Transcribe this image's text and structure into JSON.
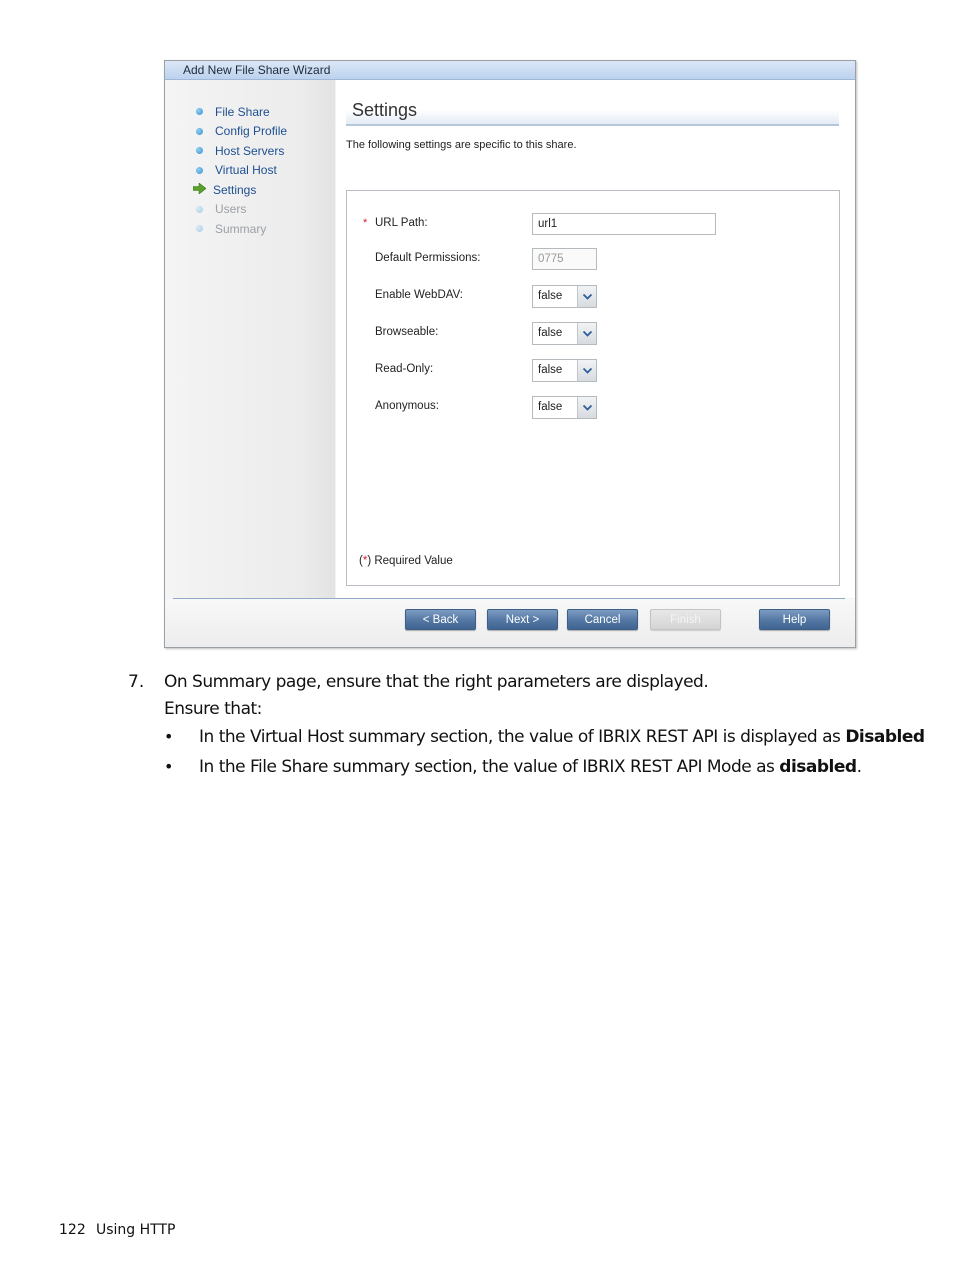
{
  "wizard": {
    "title": "Add New File Share Wizard",
    "nav": [
      {
        "label": "File Share",
        "state": "done",
        "icon": "bullet-icon"
      },
      {
        "label": "Config Profile",
        "state": "done",
        "icon": "bullet-icon"
      },
      {
        "label": "Host Servers",
        "state": "done",
        "icon": "bullet-icon"
      },
      {
        "label": "Virtual Host",
        "state": "done",
        "icon": "bullet-icon"
      },
      {
        "label": "Settings",
        "state": "current",
        "icon": "arrow-right-icon"
      },
      {
        "label": "Users",
        "state": "pending",
        "icon": "bullet-icon"
      },
      {
        "label": "Summary",
        "state": "pending",
        "icon": "bullet-icon"
      }
    ],
    "section_title": "Settings",
    "section_description": "The following settings are specific to this share.",
    "form": {
      "url_path": {
        "label": "URL Path:",
        "value": "url1",
        "required": true,
        "required_marker": "*"
      },
      "default_permissions": {
        "label": "Default Permissions:",
        "value": "0775"
      },
      "enable_webdav": {
        "label": "Enable WebDAV:",
        "value": "false"
      },
      "browseable": {
        "label": "Browseable:",
        "value": "false"
      },
      "read_only": {
        "label": "Read-Only:",
        "value": "false"
      },
      "anonymous": {
        "label": "Anonymous:",
        "value": "false"
      }
    },
    "required_note": {
      "prefix": "(",
      "star": "*",
      "suffix": ") Required Value"
    },
    "buttons": {
      "back": "< Back",
      "next": "Next >",
      "cancel": "Cancel",
      "finish": "Finish",
      "help": "Help"
    },
    "colors": {
      "accent": "#1d4f91",
      "button": "#5679a5",
      "required": "#d0203a",
      "current_step_arrow": "#5aa02c"
    }
  },
  "document": {
    "step_number": "7.",
    "step_text": "On Summary page, ensure that the right parameters are displayed.",
    "ensure_text": "Ensure that:",
    "bullets": [
      {
        "text": "In the Virtual Host summary section, the value of IBRIX REST API is displayed as ",
        "bold": "Disabled",
        "tail": ""
      },
      {
        "text": "In the File Share summary section, the value of IBRIX REST API Mode as ",
        "bold": "disabled",
        "tail": "."
      }
    ],
    "bullet_glyph": "•"
  },
  "page_footer": {
    "page_number": "122",
    "section_title": "Using HTTP"
  }
}
